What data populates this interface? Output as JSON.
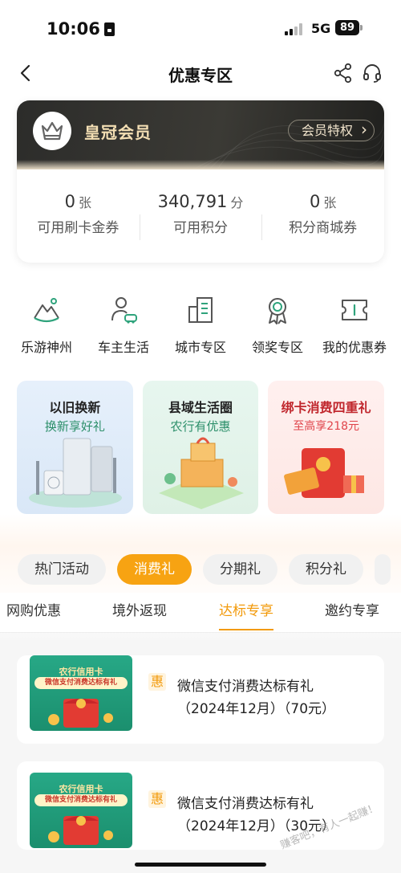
{
  "status_bar": {
    "time": "10:06",
    "network": "5G",
    "battery": "89"
  },
  "nav": {
    "title": "优惠专区"
  },
  "member_card": {
    "tier": "皇冠会员",
    "perks_button": "会员特权",
    "stats": [
      {
        "value": "0",
        "unit": "张",
        "label": "可用刷卡金券"
      },
      {
        "value": "340,791",
        "unit": "分",
        "label": "可用积分"
      },
      {
        "value": "0",
        "unit": "张",
        "label": "积分商城券"
      }
    ]
  },
  "quick_entries": [
    {
      "label": "乐游神州",
      "icon": "mountain-travel-icon"
    },
    {
      "label": "车主生活",
      "icon": "car-owner-icon"
    },
    {
      "label": "城市专区",
      "icon": "city-building-icon"
    },
    {
      "label": "领奖专区",
      "icon": "award-medal-icon"
    },
    {
      "label": "我的优惠券",
      "icon": "coupon-icon"
    }
  ],
  "banners": [
    {
      "title": "以旧换新",
      "subtitle": "换新享好礼"
    },
    {
      "title": "县域生活圈",
      "subtitle": "农行有优惠"
    },
    {
      "title": "绑卡消费四重礼",
      "subtitle": "至高享218元"
    }
  ],
  "category_pills": [
    {
      "label": "热门活动",
      "active": false
    },
    {
      "label": "消费礼",
      "active": true
    },
    {
      "label": "分期礼",
      "active": false
    },
    {
      "label": "积分礼",
      "active": false
    }
  ],
  "sub_tabs": [
    {
      "label": "网购优惠",
      "active": false
    },
    {
      "label": "境外返现",
      "active": false
    },
    {
      "label": "达标专享",
      "active": true
    },
    {
      "label": "邀约专享",
      "active": false
    }
  ],
  "activities": [
    {
      "thumb_title": "农行信用卡",
      "thumb_subtitle": "微信支付消费达标有礼",
      "badge": "惠",
      "title": "微信支付消费达标有礼",
      "detail": "（2024年12月）（70元）"
    },
    {
      "thumb_title": "农行信用卡",
      "thumb_subtitle": "微信支付消费达标有礼",
      "badge": "惠",
      "title": "微信支付消费达标有礼",
      "detail": "（2024年12月）（30元）"
    }
  ],
  "colors": {
    "accent": "#f29a0b",
    "pill_active": "#f7a312",
    "card_dark": "#2c2c2a",
    "gold_text": "#f4dfb4",
    "green": "#2c8f6a",
    "red": "#c0272d"
  },
  "watermark": "赚客吧，有人一起赚！"
}
